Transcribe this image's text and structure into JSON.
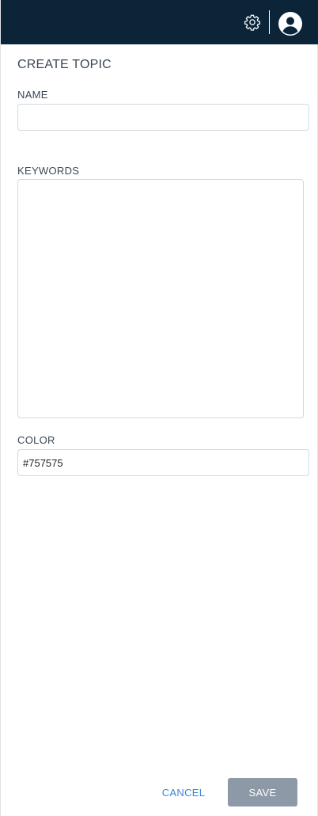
{
  "topbar": {
    "settings_icon": "gear-icon",
    "account_icon": "user-circle-icon",
    "background": "#0b2438"
  },
  "form": {
    "title": "CREATE TOPIC",
    "name_label": "NAME",
    "name_value": "",
    "keywords_label": "KEYWORDS",
    "keywords_value": "",
    "color_label": "COLOR",
    "color_value": "#757575"
  },
  "actions": {
    "cancel_label": "CANCEL",
    "save_label": "SAVE",
    "cancel_color": "#3a86d6",
    "save_background": "#8e99a7"
  }
}
